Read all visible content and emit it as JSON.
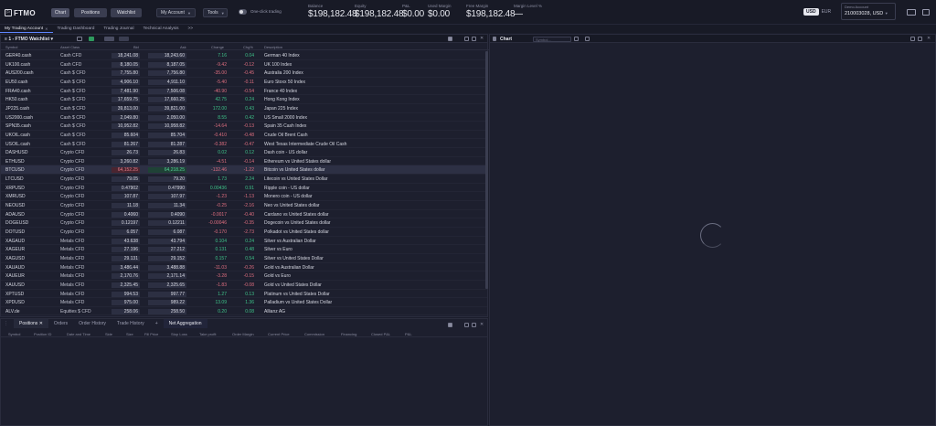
{
  "brand": {
    "name": "FTMO"
  },
  "topbar": {
    "tabs": [
      {
        "label": "Chart"
      },
      {
        "label": "Positions"
      },
      {
        "label": "Watchlist"
      }
    ],
    "my_account": "My Account",
    "tools": "Tools",
    "one_click_label": "One-click trading",
    "stats": [
      {
        "label": "Balance",
        "value": "$198,182.48"
      },
      {
        "label": "Equity",
        "value": "$198,182.48"
      },
      {
        "label": "P&L",
        "value": "$0.00"
      },
      {
        "label": "Used Margin",
        "value": "$0.00"
      },
      {
        "label": "Free Margin",
        "value": "$198,182.48"
      },
      {
        "label": "Margin Level %",
        "value": "—"
      }
    ],
    "currency": [
      "USD",
      "EUR"
    ],
    "account_label": "Demo Account",
    "account_value": "210003028, USD"
  },
  "nav": {
    "tabs": [
      "My Trading Account",
      "Trading Dashboard",
      "Trading Journal",
      "Technical Analysis"
    ],
    "more": ">>"
  },
  "watchlist": {
    "title": "1 - FTMO Watchlist",
    "columns": [
      "Symbol",
      "Asset Class",
      "Bid",
      "Ask",
      "Change",
      "Chg%",
      "Description"
    ],
    "rows": [
      {
        "sym": "GER40.cash",
        "cls": "Cash CFD",
        "bid": "18,241.08",
        "ask": "18,243.60",
        "chg": "7.16",
        "pct": "0.04",
        "desc": "German 40 Index",
        "dir": "up"
      },
      {
        "sym": "UK100.cash",
        "cls": "Cash CFD",
        "bid": "8,180.05",
        "ask": "8,187.05",
        "chg": "-9.42",
        "pct": "-0.12",
        "desc": "UK 100 Index",
        "dir": "dn"
      },
      {
        "sym": "AUS200.cash",
        "cls": "Cash $ CFD",
        "bid": "7,755.80",
        "ask": "7,756.80",
        "chg": "-35.00",
        "pct": "-0.45",
        "desc": "Australia 200 Index",
        "dir": "dn"
      },
      {
        "sym": "EU50.cash",
        "cls": "Cash $ CFD",
        "bid": "4,906.10",
        "ask": "4,911.10",
        "chg": "-5.40",
        "pct": "-0.11",
        "desc": "Euro Stoxx 50 Index",
        "dir": "dn"
      },
      {
        "sym": "FRA40.cash",
        "cls": "Cash $ CFD",
        "bid": "7,481.90",
        "ask": "7,506.08",
        "chg": "-40.90",
        "pct": "-0.54",
        "desc": "France 40 Index",
        "dir": "dn"
      },
      {
        "sym": "HK50.cash",
        "cls": "Cash $ CFD",
        "bid": "17,659.75",
        "ask": "17,660.25",
        "chg": "42.75",
        "pct": "0.24",
        "desc": "Hong Kong Index",
        "dir": "up"
      },
      {
        "sym": "JP225.cash",
        "cls": "Cash $ CFD",
        "bid": "39,813.00",
        "ask": "39,821.00",
        "chg": "172.00",
        "pct": "0.43",
        "desc": "Japan 225 Index",
        "dir": "up"
      },
      {
        "sym": "US2000.cash",
        "cls": "Cash $ CFD",
        "bid": "2,049.80",
        "ask": "2,050.00",
        "chg": "8.55",
        "pct": "0.42",
        "desc": "US Small 2000 Index",
        "dir": "up"
      },
      {
        "sym": "SPN35.cash",
        "cls": "Cash $ CFD",
        "bid": "10,952.82",
        "ask": "10,958.82",
        "chg": "-14.64",
        "pct": "-0.13",
        "desc": "Spain 35 Cash Index",
        "dir": "dn"
      },
      {
        "sym": "UKOIL.cash",
        "cls": "Cash $ CFD",
        "bid": "85.604",
        "ask": "85.704",
        "chg": "-0.410",
        "pct": "-0.48",
        "desc": "Crude Oil Brent Cash",
        "dir": "dn"
      },
      {
        "sym": "USOIL.cash",
        "cls": "Cash $ CFD",
        "bid": "81.267",
        "ask": "81.287",
        "chg": "-0.382",
        "pct": "-0.47",
        "desc": "West Texas Intermediate Crude Oil Cash",
        "dir": "dn"
      },
      {
        "sym": "DASHUSD",
        "cls": "Crypto CFD",
        "bid": "26.73",
        "ask": "26.83",
        "chg": "0.02",
        "pct": "0.12",
        "desc": "Dash coin - US dollar",
        "dir": "up"
      },
      {
        "sym": "ETHUSD",
        "cls": "Crypto CFD",
        "bid": "3,260.82",
        "ask": "3,286.19",
        "chg": "-4.51",
        "pct": "-0.14",
        "desc": "Ethereum vs United States dollar",
        "dir": "dn"
      },
      {
        "sym": "BTCUSD",
        "cls": "Crypto CFD",
        "bid": "64,152.25",
        "ask": "64,218.25",
        "chg": "-132.46",
        "pct": "-1.22",
        "desc": "Bitcoin vs United States dollar",
        "dir": "dn",
        "sel": true
      },
      {
        "sym": "LTCUSD",
        "cls": "Crypto CFD",
        "bid": "79.05",
        "ask": "79.20",
        "chg": "1.73",
        "pct": "2.24",
        "desc": "Litecoin vs United States Dollar",
        "dir": "up"
      },
      {
        "sym": "XRPUSD",
        "cls": "Crypto CFD",
        "bid": "0.47902",
        "ask": "0.47990",
        "chg": "0.00436",
        "pct": "0.91",
        "desc": "Ripple coin - US dollar",
        "dir": "up"
      },
      {
        "sym": "XMRUSD",
        "cls": "Crypto CFD",
        "bid": "107.87",
        "ask": "107.97",
        "chg": "-1.23",
        "pct": "-1.13",
        "desc": "Monero coin - US dollar",
        "dir": "dn"
      },
      {
        "sym": "NEOUSD",
        "cls": "Crypto CFD",
        "bid": "11.18",
        "ask": "11.34",
        "chg": "-0.25",
        "pct": "-2.16",
        "desc": "Neo vs United States dollar",
        "dir": "dn"
      },
      {
        "sym": "ADAUSD",
        "cls": "Crypto CFD",
        "bid": "0.4060",
        "ask": "0.4090",
        "chg": "-0.0017",
        "pct": "-0.40",
        "desc": "Cardano vs United States dollar",
        "dir": "dn"
      },
      {
        "sym": "DOGEUSD",
        "cls": "Crypto CFD",
        "bid": "0.12197",
        "ask": "0.12211",
        "chg": "-0.00046",
        "pct": "-0.35",
        "desc": "Dogecoin vs United States dollar",
        "dir": "dn"
      },
      {
        "sym": "DOTUSD",
        "cls": "Crypto CFD",
        "bid": "6.057",
        "ask": "6.087",
        "chg": "-0.170",
        "pct": "-2.73",
        "desc": "Polkadot vs United States dollar",
        "dir": "dn"
      },
      {
        "sym": "XAGAUD",
        "cls": "Metals CFD",
        "bid": "43.638",
        "ask": "43.794",
        "chg": "0.104",
        "pct": "0.24",
        "desc": "Silver vs Australian Dollar",
        "dir": "up"
      },
      {
        "sym": "XAGEUR",
        "cls": "Metals CFD",
        "bid": "27.196",
        "ask": "27.212",
        "chg": "0.131",
        "pct": "0.48",
        "desc": "Silver vs Euro",
        "dir": "up"
      },
      {
        "sym": "XAGUSD",
        "cls": "Metals CFD",
        "bid": "29.131",
        "ask": "29.152",
        "chg": "0.157",
        "pct": "0.54",
        "desc": "Silver vs United States Dollar",
        "dir": "up"
      },
      {
        "sym": "XAUAUD",
        "cls": "Metals CFD",
        "bid": "3,486.44",
        "ask": "3,488.88",
        "chg": "-11.03",
        "pct": "-0.26",
        "desc": "Gold vs Australian Dollar",
        "dir": "dn"
      },
      {
        "sym": "XAUEUR",
        "cls": "Metals CFD",
        "bid": "2,170.76",
        "ask": "2,171.14",
        "chg": "-3.28",
        "pct": "-0.15",
        "desc": "Gold vs Euro",
        "dir": "dn"
      },
      {
        "sym": "XAUUSD",
        "cls": "Metals CFD",
        "bid": "2,325.45",
        "ask": "2,325.65",
        "chg": "-1.83",
        "pct": "-0.08",
        "desc": "Gold vs United States Dollar",
        "dir": "dn"
      },
      {
        "sym": "XPTUSD",
        "cls": "Metals CFD",
        "bid": "994.53",
        "ask": "997.77",
        "chg": "1.27",
        "pct": "0.13",
        "desc": "Platinum vs United States Dollar",
        "dir": "up"
      },
      {
        "sym": "XPDUSD",
        "cls": "Metals CFD",
        "bid": "975.00",
        "ask": "989.22",
        "chg": "13.09",
        "pct": "1.36",
        "desc": "Palladium vs United States Dollar",
        "dir": "up"
      },
      {
        "sym": "ALV.de",
        "cls": "Equities $ CFD",
        "bid": "258.06",
        "ask": "258.50",
        "chg": "0.20",
        "pct": "0.08",
        "desc": "Allianz AG",
        "dir": "up"
      }
    ]
  },
  "chart": {
    "title": "Chart",
    "search_placeholder": "Symbol..."
  },
  "bottom": {
    "tabs": [
      "Positions",
      "Orders",
      "Order History",
      "Trade History",
      "Net Aggregation"
    ],
    "columns": [
      "Symbol",
      "Position ID",
      "Date and Time",
      "Side",
      "Size",
      "Fill Price",
      "Stop Loss",
      "Take profit",
      "Order Margin",
      "Current Price",
      "Commission",
      "Financing",
      "Closed P&L",
      "P&L"
    ]
  },
  "colors": {
    "accent": "#5e86ff",
    "up": "#3ec48a",
    "down": "#e06f80",
    "background": "#1b1d2b"
  }
}
